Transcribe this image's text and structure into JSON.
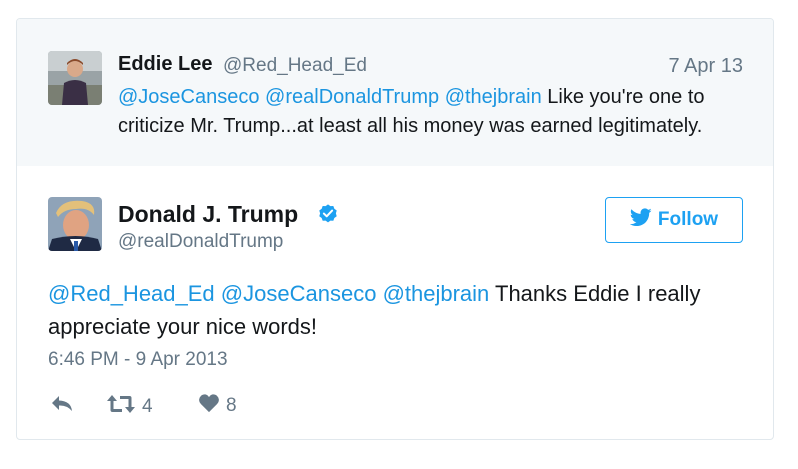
{
  "parent_tweet": {
    "name": "Eddie Lee",
    "handle": "@Red_Head_Ed",
    "date": "7 Apr 13",
    "mentions": [
      "@JoseCanseco",
      "@realDonaldTrump",
      "@thejbrain"
    ],
    "text_line1_rest": " Like you're one to",
    "text_line2": "criticize Mr. Trump...at least all his money was earned legitimately."
  },
  "main_tweet": {
    "name": "Donald J. Trump",
    "handle": "@realDonaldTrump",
    "follow_label": "Follow",
    "mentions": [
      "@Red_Head_Ed",
      "@JoseCanseco",
      "@thejbrain"
    ],
    "text_rest": " Thanks Eddie I really appreciate your nice words!",
    "timestamp": "6:46 PM - 9 Apr 2013",
    "retweet_count": "4",
    "like_count": "8"
  },
  "colors": {
    "link": "#1b95e0",
    "follow": "#1da1f2",
    "muted": "#657786",
    "parent_bg": "#f5f8fa",
    "border": "#e1e8ed"
  },
  "icons": [
    "reply-icon",
    "retweet-icon",
    "heart-icon",
    "verified-badge-icon",
    "twitter-bird-icon"
  ]
}
